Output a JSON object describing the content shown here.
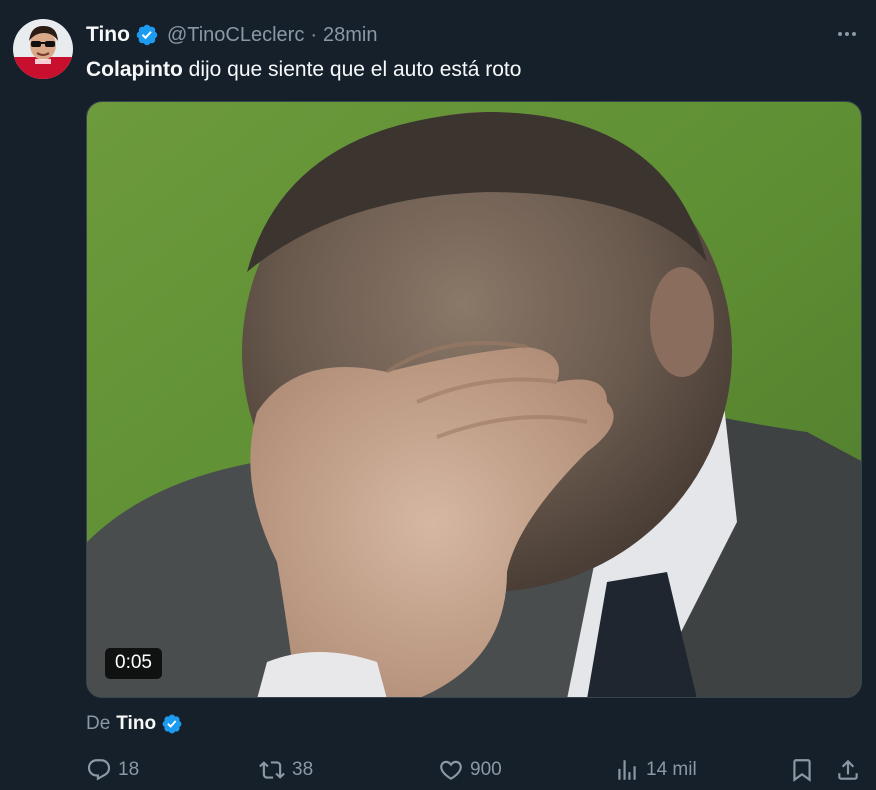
{
  "author": {
    "name": "Tino",
    "handle": "@TinoCLeclerc",
    "separator": "·",
    "time": "28min",
    "verified": true
  },
  "tweet": {
    "bold_text": "Colapinto",
    "text": " dijo que siente que el auto está roto"
  },
  "media": {
    "type": "video",
    "duration": "0:05"
  },
  "attribution": {
    "prefix": "De",
    "name": "Tino"
  },
  "actions": {
    "replies": "18",
    "reposts": "38",
    "likes": "900",
    "views": "14 mil"
  },
  "icons": {
    "verified": "verified-badge-icon",
    "more": "more-horizontal-icon",
    "reply": "reply-icon",
    "repost": "repost-icon",
    "like": "heart-icon",
    "views": "analytics-icon",
    "bookmark": "bookmark-icon",
    "share": "share-icon"
  },
  "colors": {
    "background": "#15202b",
    "text_primary": "#f7f9f9",
    "text_secondary": "#8b98a5",
    "verified": "#1d9bf0"
  }
}
